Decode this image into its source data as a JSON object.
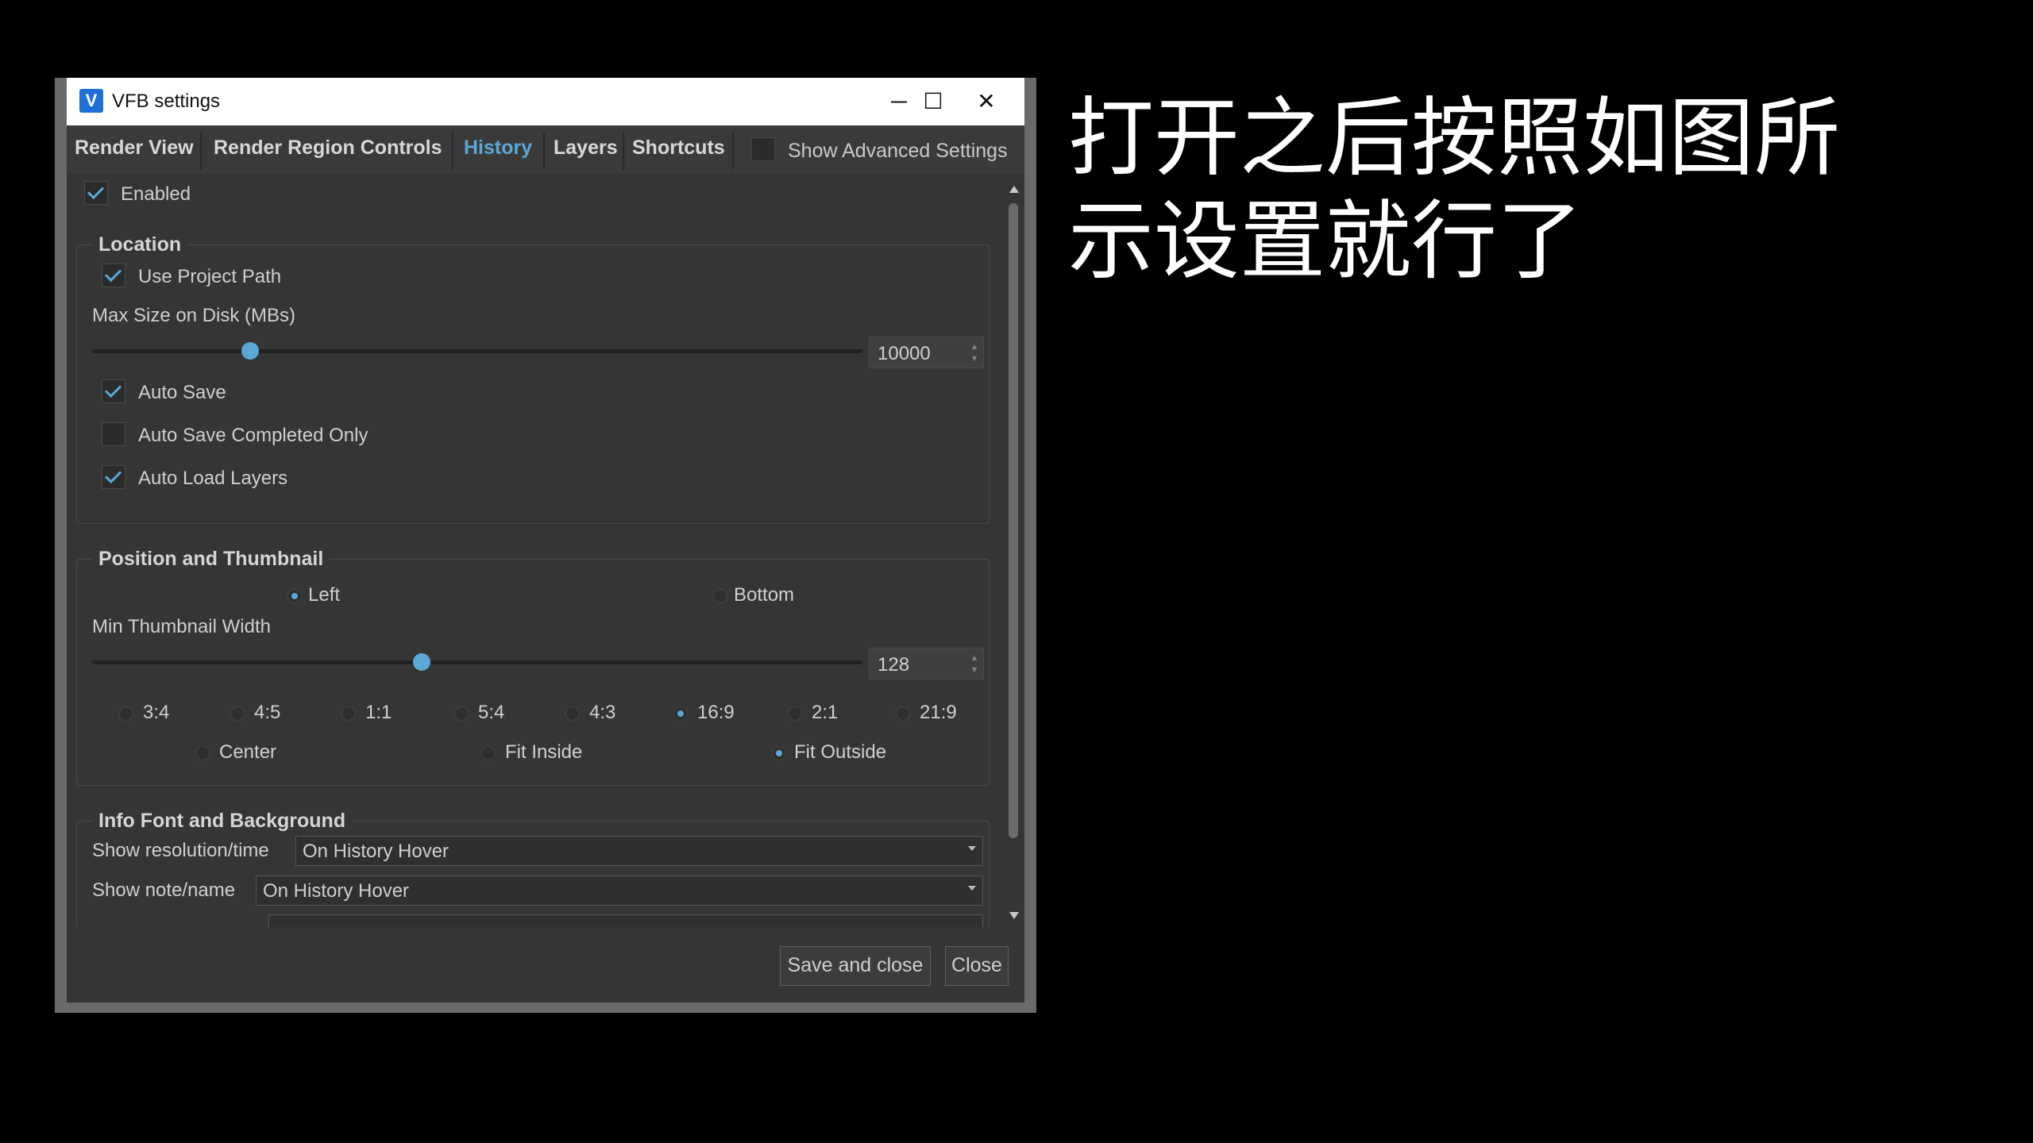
{
  "window": {
    "title": "VFB settings",
    "icon": "V",
    "controls": {
      "minimize": "─",
      "maximize": "☐",
      "close": "✕"
    }
  },
  "tabs": [
    {
      "label": "Render View"
    },
    {
      "label": "Render Region Controls"
    },
    {
      "label": "History",
      "active": true
    },
    {
      "label": "Layers"
    },
    {
      "label": "Shortcuts"
    }
  ],
  "advanced": {
    "label": "Show Advanced Settings",
    "checked": false
  },
  "enabled": {
    "label": "Enabled",
    "checked": true
  },
  "location": {
    "title": "Location",
    "use_project_path": "Use Project Path",
    "max_size_label": "Max Size on Disk (MBs)",
    "max_size_value": "10000",
    "max_size_fraction": 0.2,
    "auto_save": "Auto Save",
    "auto_save_completed": "Auto Save Completed Only",
    "auto_load_layers": "Auto Load Layers"
  },
  "position": {
    "title": "Position and Thumbnail",
    "left": "Left",
    "bottom": "Bottom",
    "selected_position": "Left",
    "min_width_label": "Min Thumbnail Width",
    "min_width_value": "128",
    "min_width_fraction": 0.43,
    "ratios": [
      "3:4",
      "4:5",
      "1:1",
      "5:4",
      "4:3",
      "16:9",
      "2:1",
      "21:9"
    ],
    "selected_ratio": "16:9",
    "fit": [
      "Center",
      "Fit Inside",
      "Fit Outside"
    ],
    "selected_fit": "Fit Outside"
  },
  "info": {
    "title": "Info Font and Background",
    "resolution_label": "Show resolution/time",
    "resolution_value": "On History Hover",
    "note_label": "Show note/name",
    "note_value": "On History Hover"
  },
  "buttons": {
    "save_close": "Save and close",
    "close": "Close"
  },
  "caption": {
    "line1": "打开之后按照如图所",
    "line2": "示设置就行了"
  },
  "colors": {
    "accent": "#5aa8d8",
    "panel": "#353535",
    "titlebar": "#ffffff"
  }
}
